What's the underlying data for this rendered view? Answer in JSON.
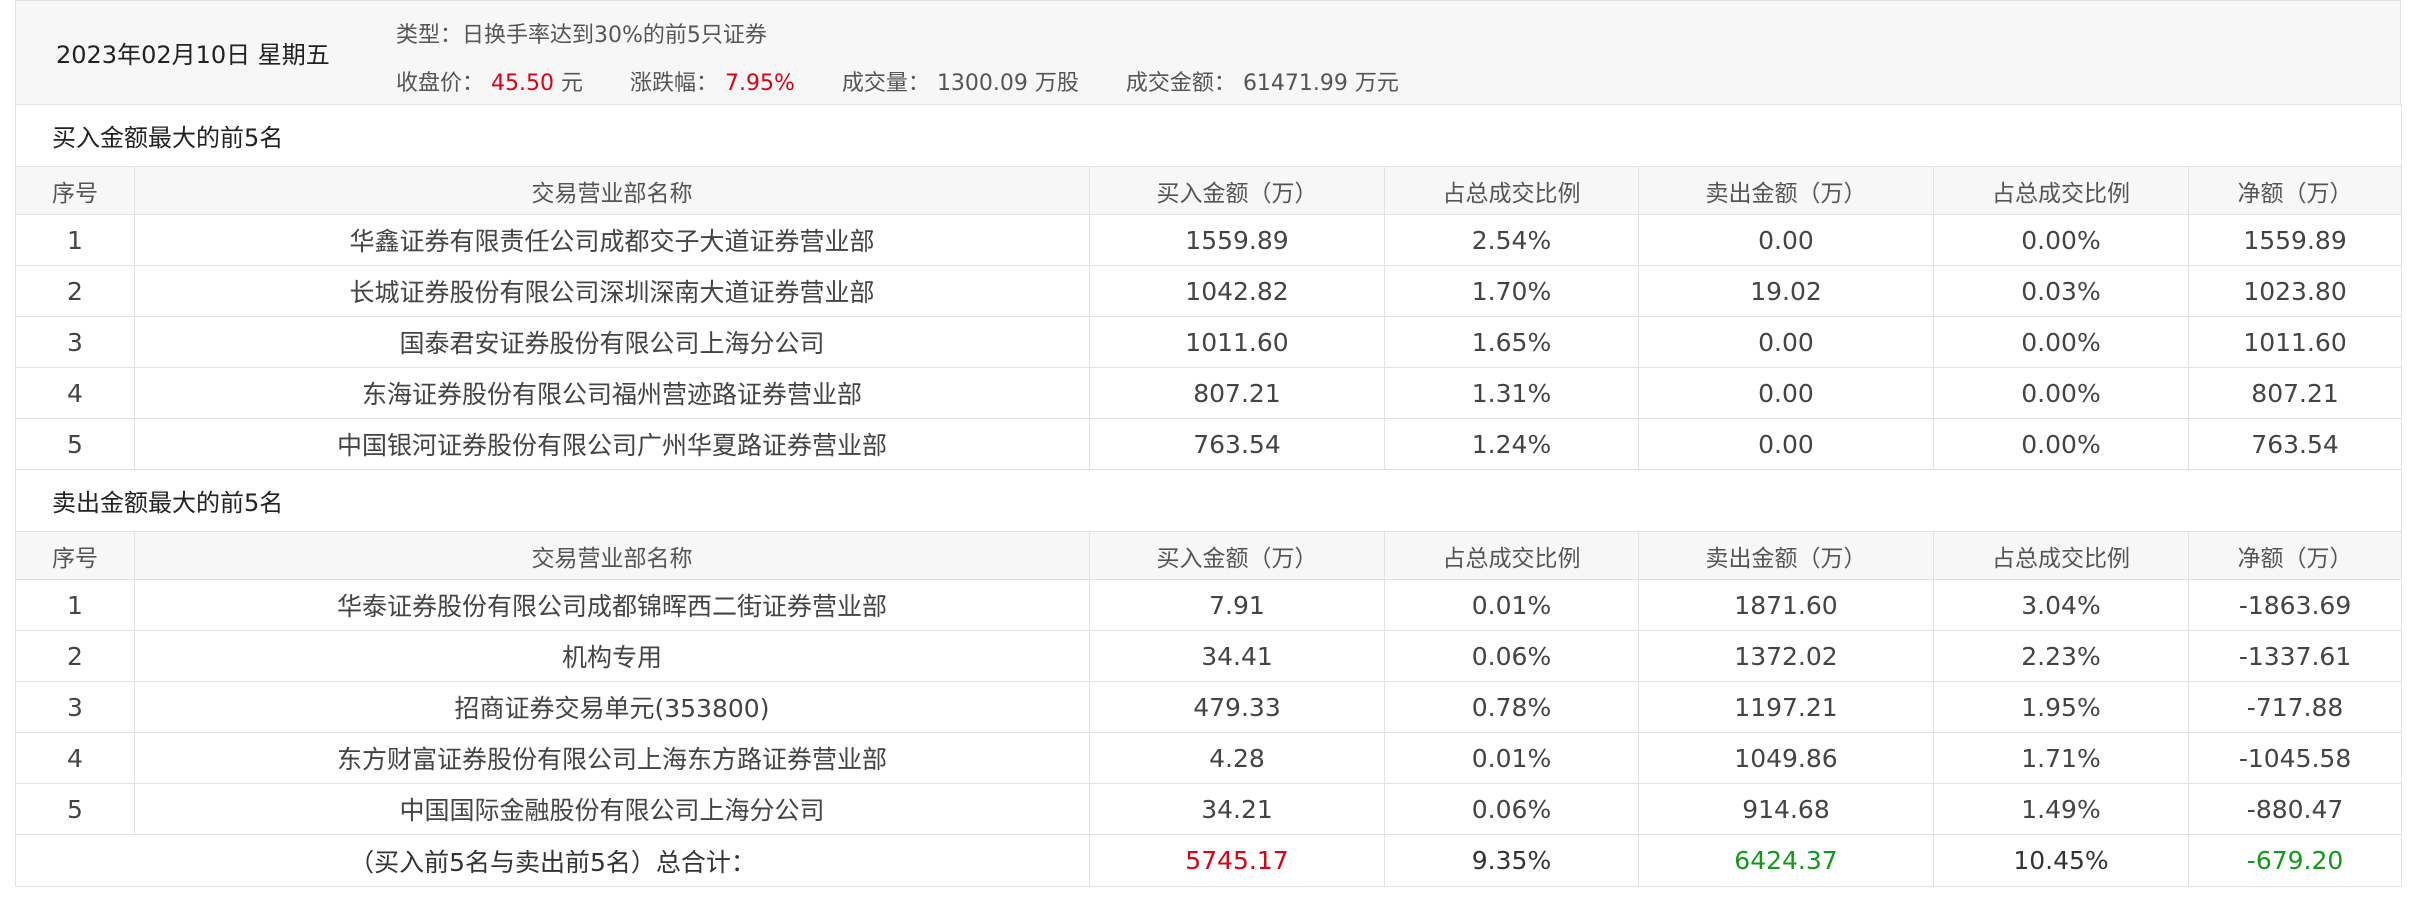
{
  "header": {
    "date": "2023年02月10日 星期五",
    "type": "类型：日换手率达到30%的前5只证券",
    "close_label": "收盘价：",
    "close_value": "45.50",
    "close_unit": "元",
    "change_label": "涨跌幅：",
    "change_value": "7.95%",
    "volume_label": "成交量：",
    "volume_value": "1300.09 万股",
    "turnover_label": "成交金额：",
    "turnover_value": "61471.99 万元"
  },
  "columns": [
    "序号",
    "交易营业部名称",
    "买入金额（万）",
    "占总成交比例",
    "卖出金额（万）",
    "占总成交比例",
    "净额（万）"
  ],
  "buy_section": {
    "title": "买入金额最大的前5名",
    "rows": [
      {
        "no": "1",
        "name": "华鑫证券有限责任公司成都交子大道证券营业部",
        "buy": "1559.89",
        "buy_pct": "2.54%",
        "sell": "0.00",
        "sell_pct": "0.00%",
        "net": "1559.89"
      },
      {
        "no": "2",
        "name": "长城证券股份有限公司深圳深南大道证券营业部",
        "buy": "1042.82",
        "buy_pct": "1.70%",
        "sell": "19.02",
        "sell_pct": "0.03%",
        "net": "1023.80"
      },
      {
        "no": "3",
        "name": "国泰君安证券股份有限公司上海分公司",
        "buy": "1011.60",
        "buy_pct": "1.65%",
        "sell": "0.00",
        "sell_pct": "0.00%",
        "net": "1011.60"
      },
      {
        "no": "4",
        "name": "东海证券股份有限公司福州营迹路证券营业部",
        "buy": "807.21",
        "buy_pct": "1.31%",
        "sell": "0.00",
        "sell_pct": "0.00%",
        "net": "807.21"
      },
      {
        "no": "5",
        "name": "中国银河证券股份有限公司广州华夏路证券营业部",
        "buy": "763.54",
        "buy_pct": "1.24%",
        "sell": "0.00",
        "sell_pct": "0.00%",
        "net": "763.54"
      }
    ]
  },
  "sell_section": {
    "title": "卖出金额最大的前5名",
    "rows": [
      {
        "no": "1",
        "name": "华泰证券股份有限公司成都锦晖西二街证券营业部",
        "buy": "7.91",
        "buy_pct": "0.01%",
        "sell": "1871.60",
        "sell_pct": "3.04%",
        "net": "-1863.69"
      },
      {
        "no": "2",
        "name": "机构专用",
        "buy": "34.41",
        "buy_pct": "0.06%",
        "sell": "1372.02",
        "sell_pct": "2.23%",
        "net": "-1337.61"
      },
      {
        "no": "3",
        "name": "招商证券交易单元(353800)",
        "buy": "479.33",
        "buy_pct": "0.78%",
        "sell": "1197.21",
        "sell_pct": "1.95%",
        "net": "-717.88"
      },
      {
        "no": "4",
        "name": "东方财富证券股份有限公司上海东方路证券营业部",
        "buy": "4.28",
        "buy_pct": "0.01%",
        "sell": "1049.86",
        "sell_pct": "1.71%",
        "net": "-1045.58"
      },
      {
        "no": "5",
        "name": "中国国际金融股份有限公司上海分公司",
        "buy": "34.21",
        "buy_pct": "0.06%",
        "sell": "914.68",
        "sell_pct": "1.49%",
        "net": "-880.47"
      }
    ]
  },
  "total": {
    "label": "（买入前5名与卖出前5名）总合计：",
    "buy": "5745.17",
    "buy_pct": "9.35%",
    "sell": "6424.37",
    "sell_pct": "10.45%",
    "net": "-679.20"
  },
  "colors": {
    "red": "#e0000f",
    "green": "#119a1a"
  }
}
